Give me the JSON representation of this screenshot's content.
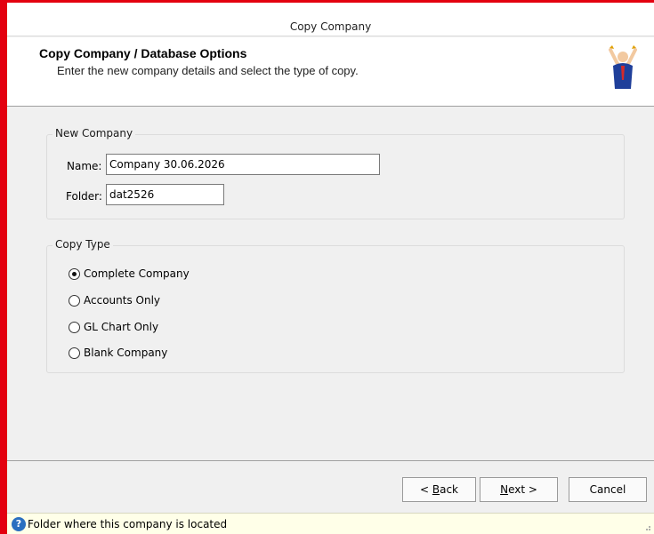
{
  "window": {
    "title": "Copy Company"
  },
  "header": {
    "title": "Copy Company / Database Options",
    "subtitle": "Enter the new company details and select the type of copy."
  },
  "new_company": {
    "legend": "New Company",
    "name_label": "Name:",
    "name_value": "Company 30.06.2026",
    "folder_label": "Folder:",
    "folder_value": "dat2526"
  },
  "copy_type": {
    "legend": "Copy Type",
    "options": [
      {
        "label": "Complete Company",
        "selected": true
      },
      {
        "label": "Accounts Only",
        "selected": false
      },
      {
        "label": "GL Chart Only",
        "selected": false
      },
      {
        "label": "Blank Company",
        "selected": false
      }
    ]
  },
  "buttons": {
    "back_mnemonic": "B",
    "back_rest": "ack",
    "back_prefix": "< ",
    "next_mnemonic": "N",
    "next_rest": "ext >",
    "cancel": "Cancel"
  },
  "status": {
    "text": "Folder where this company is located",
    "icon": "help-icon"
  },
  "colors": {
    "frame_accent": "#e3000f",
    "status_bg": "#ffffe8",
    "help_icon": "#2a6fc0"
  }
}
